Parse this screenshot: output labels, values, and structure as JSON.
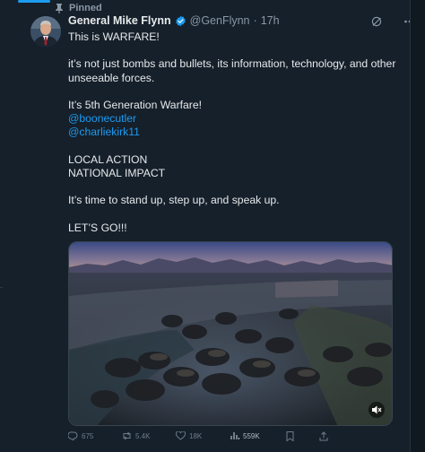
{
  "pinned_label": "Pinned",
  "author": {
    "name": "General Mike Flynn",
    "handle": "@GenFlynn",
    "separator": "·",
    "time": "17h"
  },
  "post": {
    "line1": "This is WARFARE!",
    "line2": "it’s not just bombs and bullets, its information, technology, and other unseeable forces.",
    "line3": "It’s 5th Generation Warfare!",
    "mention1": "@boonecutler",
    "mention2": "@charliekirk11",
    "line4": "LOCAL ACTION",
    "line5": "NATIONAL IMPACT",
    "line6": "It’s time to stand up, step up, and speak up.",
    "line7": "LET’S GO!!!"
  },
  "actions": {
    "replies": "675",
    "reposts": "5.4K",
    "likes": "18K",
    "views": "559K"
  },
  "icons": {
    "pin": "pin-icon",
    "verified": "verified-badge-icon",
    "more": "more-icon",
    "grok": "grok-icon",
    "mute": "mute-icon",
    "reply": "reply-icon",
    "repost": "repost-icon",
    "like": "like-icon",
    "views": "views-icon",
    "bookmark": "bookmark-icon",
    "share": "share-icon"
  },
  "colors": {
    "background": "#15202b",
    "accent": "#1d9bf0",
    "text": "#e7e9ea",
    "muted": "#8b98a5"
  }
}
